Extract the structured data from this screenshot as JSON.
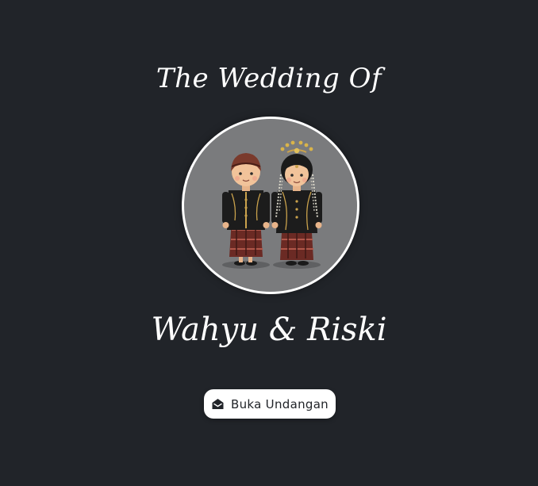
{
  "cover": {
    "title": "The Wedding Of",
    "couple_names": "Wahyu & Riski",
    "open_button_label": "Buka Undangan",
    "open_button_icon": "envelope-open-icon",
    "photo": "couple-illustration"
  },
  "colors": {
    "background": "#212429",
    "text": "#ffffff",
    "button_bg": "#ffffff",
    "button_text": "#212429",
    "photo_bg": "#7a7b7d"
  }
}
